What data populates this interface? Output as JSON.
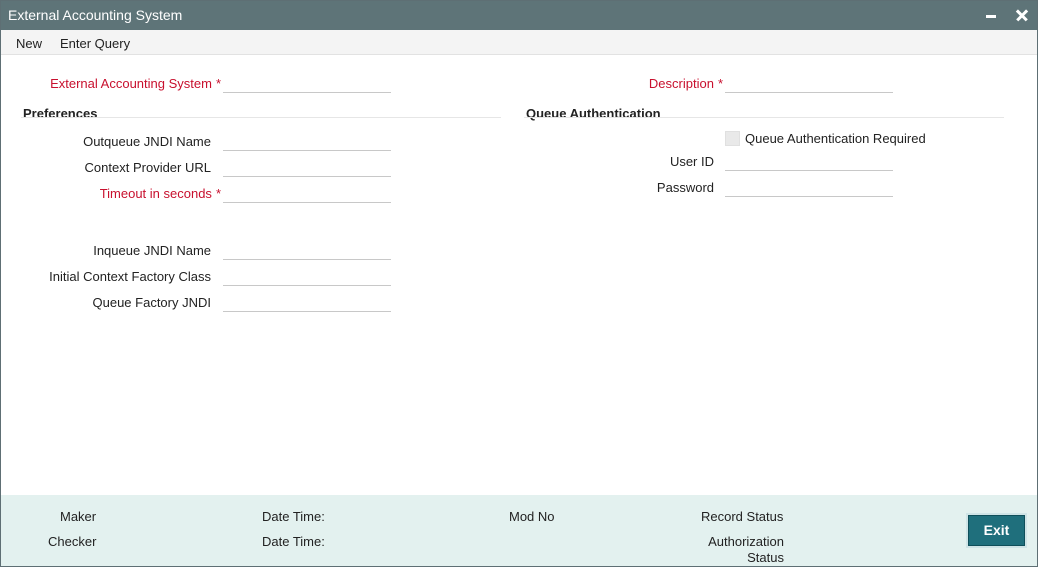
{
  "window": {
    "title": "External Accounting System"
  },
  "menu": {
    "new": "New",
    "enter_query": "Enter Query"
  },
  "form": {
    "external_accounting_system": {
      "label": "External Accounting System",
      "required": "*",
      "value": ""
    },
    "description": {
      "label": "Description",
      "required": "*",
      "value": ""
    }
  },
  "preferences": {
    "heading": "Preferences",
    "outqueue_jndi_name": {
      "label": "Outqueue JNDI Name",
      "value": ""
    },
    "context_provider_url": {
      "label": "Context Provider URL",
      "value": ""
    },
    "timeout_in_seconds": {
      "label": "Timeout in seconds",
      "required": "*",
      "value": ""
    },
    "inqueue_jndi_name": {
      "label": "Inqueue JNDI Name",
      "value": ""
    },
    "initial_context_factory_class": {
      "label": "Initial Context Factory Class",
      "value": ""
    },
    "queue_factory_jndi": {
      "label": "Queue Factory JNDI",
      "value": ""
    }
  },
  "queue_authentication": {
    "heading": "Queue Authentication",
    "required_checkbox": {
      "label": "Queue Authentication Required",
      "checked": false
    },
    "user_id": {
      "label": "User ID",
      "value": ""
    },
    "password": {
      "label": "Password",
      "value": ""
    }
  },
  "footer": {
    "maker": "Maker",
    "maker_date_time": "Date Time:",
    "mod_no": "Mod No",
    "record_status": "Record Status",
    "checker": "Checker",
    "checker_date_time": "Date Time:",
    "authorization_status_line1": "Authorization",
    "authorization_status_line2": "Status",
    "exit": "Exit"
  },
  "colors": {
    "titlebar": "#5e7478",
    "required": "#c8102e",
    "footer": "#e3f1ef",
    "exit_button": "#1f6f7c"
  }
}
